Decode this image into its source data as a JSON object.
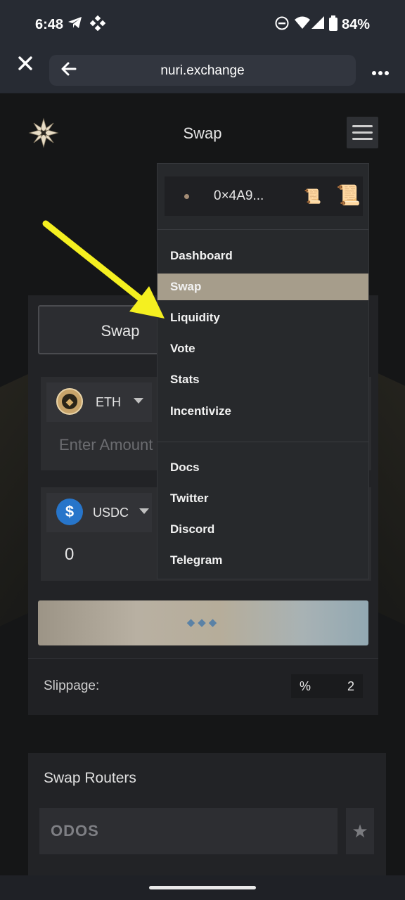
{
  "status_bar": {
    "time": "6:48",
    "battery": "84%"
  },
  "browser": {
    "url": "nuri.exchange",
    "close_icon": "close-icon",
    "back_icon": "back-arrow-icon",
    "more_icon": "more-icon"
  },
  "header": {
    "title": "Swap"
  },
  "swap_card": {
    "tab_label": "Swap",
    "from_token": {
      "symbol": "ETH",
      "amount_placeholder": "Enter Amount"
    },
    "to_token": {
      "symbol": "USDC",
      "amount": "0"
    },
    "action_button": "◆◆◆",
    "slippage_label": "Slippage:",
    "slippage_unit": "%",
    "slippage_value": "2"
  },
  "routers": {
    "title": "Swap Routers",
    "items": [
      {
        "name": "ODOS"
      }
    ]
  },
  "menu": {
    "wallet_address": "0×4A9...",
    "items": [
      {
        "label": "Dashboard"
      },
      {
        "label": "Swap"
      },
      {
        "label": "Liquidity"
      },
      {
        "label": "Vote"
      },
      {
        "label": "Stats"
      },
      {
        "label": "Incentivize"
      }
    ],
    "links": [
      {
        "label": "Docs"
      },
      {
        "label": "Twitter"
      },
      {
        "label": "Discord"
      },
      {
        "label": "Telegram"
      }
    ],
    "active_item": "Swap"
  },
  "colors": {
    "arrow": "#f5f020",
    "menu_active": "#a69d8b",
    "accent_usdc": "#2775ca"
  }
}
